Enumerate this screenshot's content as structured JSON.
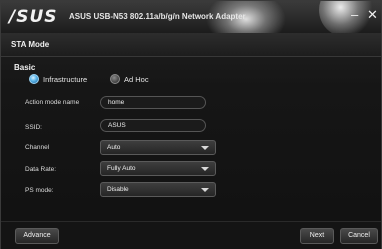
{
  "window": {
    "logo": "/SUS",
    "title": "ASUS USB-N53 802.11a/b/g/n Network Adapter",
    "minimize": "–",
    "close": "✕"
  },
  "header": {
    "title": "STA Mode"
  },
  "basic": {
    "section_label": "Basic",
    "mode_options": [
      {
        "label": "Infrastructure",
        "selected": true
      },
      {
        "label": "Ad Hoc",
        "selected": false
      }
    ]
  },
  "form": {
    "action_mode_name": {
      "label": "Action mode name",
      "value": "home"
    },
    "ssid": {
      "label": "SSID:",
      "value": "ASUS"
    },
    "channel": {
      "label": "Channel",
      "value": "Auto"
    },
    "data_rate": {
      "label": "Data Rate:",
      "value": "Fully Auto"
    },
    "ps_mode": {
      "label": "PS mode:",
      "value": "Disable"
    }
  },
  "buttons": {
    "advance": "Advance",
    "next": "Next",
    "cancel": "Cancel"
  },
  "colors": {
    "accent": "#5ab4e8",
    "background": "#111111"
  }
}
